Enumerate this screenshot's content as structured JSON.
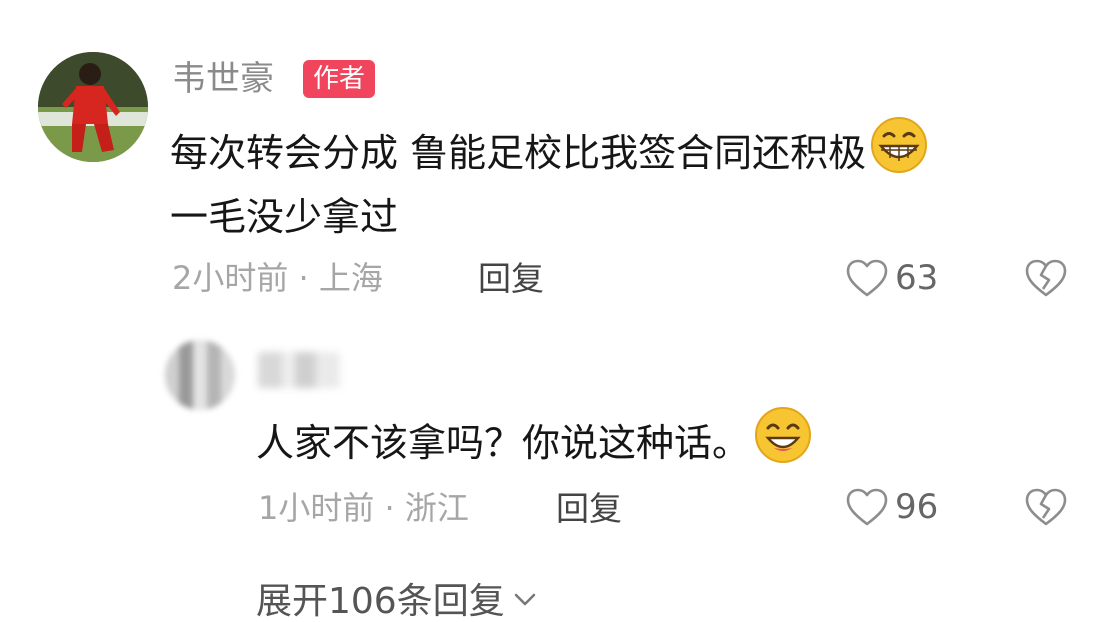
{
  "comment": {
    "username": "韦世豪",
    "badge": "作者",
    "text_line1": "每次转会分成 鲁能足校比我签合同还积极",
    "text_line2": "一毛没少拿过",
    "emoji": "grinning-face",
    "time": "2小时前",
    "location": "上海",
    "reply_label": "回复",
    "likes": "63"
  },
  "reply": {
    "text": "人家不该拿吗？你说这种话。",
    "emoji": "smiling-face",
    "time": "1小时前",
    "location": "浙江",
    "reply_label": "回复",
    "likes": "96"
  },
  "expand": {
    "label": "展开106条回复"
  },
  "colors": {
    "badge": "#f0455c",
    "text": "#161616",
    "meta": "#a6a6a6"
  }
}
